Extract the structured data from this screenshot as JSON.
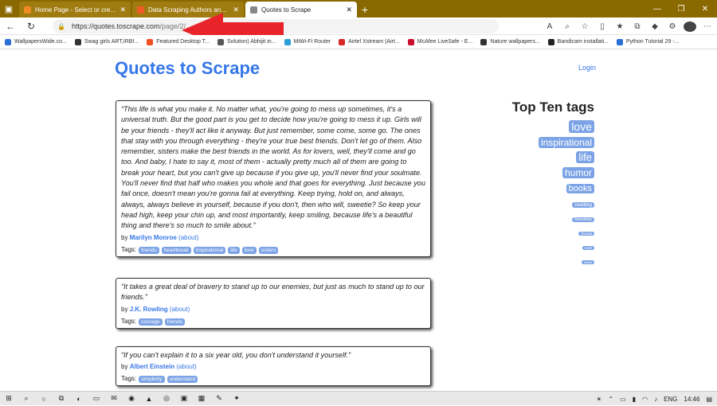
{
  "browser": {
    "tabs": [
      {
        "title": "Home Page - Select or create a b",
        "active": false,
        "favicon_color": "#f08a24"
      },
      {
        "title": "Data Scraping Authors and Quot",
        "active": false,
        "favicon_color": "#f05a24"
      },
      {
        "title": "Quotes to Scrape",
        "active": true,
        "favicon_color": "#888888"
      }
    ],
    "address": {
      "host": "https://quotes.toscrape.com",
      "path": "/page/2/"
    },
    "bookmarks": [
      {
        "label": "WallpapersWide.co...",
        "color": "#2a6fd6"
      },
      {
        "label": "Swag girls ART,IRBI...",
        "color": "#333333"
      },
      {
        "label": "Featured Desktop T...",
        "color": "#f25022"
      },
      {
        "label": "Solution) Abhijit in...",
        "color": "#555555"
      },
      {
        "label": "MiWi-Fi Router",
        "color": "#2a9fd6"
      },
      {
        "label": "Airtel Xstream (Airt...",
        "color": "#d62a2a"
      },
      {
        "label": "McAfee LiveSafe - E...",
        "color": "#c8102e"
      },
      {
        "label": "Nature wallpapers...",
        "color": "#333333"
      },
      {
        "label": "Bandicam installati...",
        "color": "#222222"
      },
      {
        "label": "Python Tutorial 29 -...",
        "color": "#2a6fd6"
      }
    ]
  },
  "site": {
    "title": "Quotes to Scrape",
    "login": "Login"
  },
  "quotes": [
    {
      "text": "“This life is what you make it. No matter what, you're going to mess up sometimes, it's a universal truth. But the good part is you get to decide how you're going to mess it up. Girls will be your friends - they'll act like it anyway. But just remember, some come, some go. The ones that stay with you through everything - they're your true best friends. Don't let go of them. Also remember, sisters make the best friends in the world. As for lovers, well, they'll come and go too. And baby, I hate to say it, most of them - actually pretty much all of them are going to break your heart, but you can't give up because if you give up, you'll never find your soulmate. You'll never find that half who makes you whole and that goes for everything. Just because you fail once, doesn't mean you're gonna fail at everything. Keep trying, hold on, and always, always, always believe in yourself, because if you don't, then who will, sweetie? So keep your head high, keep your chin up, and most importantly, keep smiling, because life's a beautiful thing and there's so much to smile about.”",
      "author": "Marilyn Monroe",
      "tags": [
        "friends",
        "heartbreak",
        "inspirational",
        "life",
        "love",
        "sisters"
      ]
    },
    {
      "text": "“It takes a great deal of bravery to stand up to our enemies, but just as much to stand up to our friends.”",
      "author": "J.K. Rowling",
      "tags": [
        "courage",
        "friends"
      ]
    },
    {
      "text": "“If you can't explain it to a six year old, you don't understand it yourself.”",
      "author": "Albert Einstein",
      "tags": [
        "simplicity",
        "understand"
      ]
    }
  ],
  "labels": {
    "by": "by",
    "about": "(about)",
    "tags": "Tags:"
  },
  "top_tags": {
    "title": "Top Ten tags",
    "items": [
      {
        "name": "love",
        "size": 14
      },
      {
        "name": "inspirational",
        "size": 12
      },
      {
        "name": "life",
        "size": 13
      },
      {
        "name": "humor",
        "size": 12
      },
      {
        "name": "books",
        "size": 11
      },
      {
        "name": "reading",
        "size": 6.5
      },
      {
        "name": "friendship",
        "size": 5
      },
      {
        "name": "friends",
        "size": 4.5
      },
      {
        "name": "truth",
        "size": 4.5
      },
      {
        "name": "simile",
        "size": 4
      }
    ]
  },
  "taskbar": {
    "lang": "ENG",
    "time": "14:46"
  },
  "colors": {
    "tabbar": "#8a6a00",
    "link": "#3677e8",
    "tag": "#7ca3e5",
    "arrow": "#e8232a"
  }
}
